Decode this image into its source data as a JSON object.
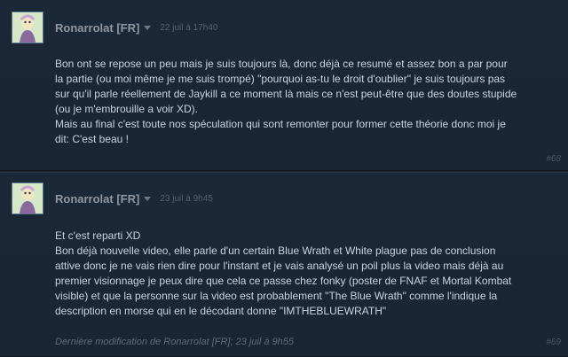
{
  "posts": [
    {
      "author": "Ronarrolat [FR]",
      "date": "22 juil à 17h40",
      "content": "Bon ont se repose un peu mais je suis toujours là, donc déjà ce resumé et assez bon a par pour\nla partie (ou moi même je me suis trompé) \"pourquoi as-tu le droit d'oublier\" je suis toujours pas\nsur qu'il parle réellement de Jaykill a ce moment là mais ce n'est peut-être que des doutes stupide\n(ou je m'embrouille a voir XD).\nMais au final c'est toute nos spéculation qui sont remonter pour former cette théorie donc moi je\ndit: C'est beau !",
      "number": "#68",
      "modified": ""
    },
    {
      "author": "Ronarrolat [FR]",
      "date": "23 juil à 9h45",
      "content": "Et c'est reparti XD\nBon déjà nouvelle video, elle parle d'un certain Blue Wrath et White plague pas de conclusion\nattive donc je ne vais rien dire pour l'instant et je vais analysé un poil plus la video mais déjà au\npremier visionnage je peux dire que cela ce passe chez fonky (poster de FNAF et Mortal Kombat\nvisible) et que la personne sur la video est probablement \"The Blue Wrath\" comme l'indique la\ndescription en morse qui en le décodant donne \"IMTHEBLUEWRATH\"",
      "number": "#69",
      "modified": "Dernière modification de Ronarrolat [FR]; 23 juil à 9h55"
    }
  ]
}
